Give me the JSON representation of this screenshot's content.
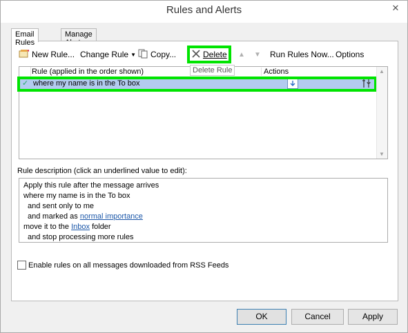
{
  "window": {
    "title": "Rules and Alerts",
    "close": "✕"
  },
  "tabs": [
    {
      "label": "Email Rules",
      "active": true
    },
    {
      "label": "Manage Alerts",
      "active": false
    }
  ],
  "toolbar": {
    "new_rule": "New Rule...",
    "change_rule": "Change Rule",
    "copy": "Copy...",
    "delete": "Delete",
    "run_rules_now": "Run Rules Now...",
    "options": "Options",
    "tooltip": "Delete Rule"
  },
  "rules_list": {
    "columns": {
      "rule": "Rule (applied in the order shown)",
      "actions": "Actions"
    },
    "rows": [
      {
        "name": "where my name is in the To box",
        "enabled": true,
        "selected": true
      }
    ]
  },
  "description": {
    "label": "Rule description (click an underlined value to edit):",
    "line1": "Apply this rule after the message arrives",
    "line2": "where my name is in the To box",
    "line3": "and sent only to me",
    "line4_prefix": "and marked as ",
    "line4_link": "normal importance",
    "line5_prefix": "move it to the ",
    "line5_link": "Inbox",
    "line5_suffix": " folder",
    "line6": "and stop processing more rules"
  },
  "rss": {
    "label": "Enable rules on all messages downloaded from RSS Feeds",
    "checked": false
  },
  "buttons": {
    "ok": "OK",
    "cancel": "Cancel",
    "apply": "Apply"
  },
  "colors": {
    "highlight": "#00e400",
    "selection": "#b3cbef",
    "link": "#1a56a8"
  }
}
